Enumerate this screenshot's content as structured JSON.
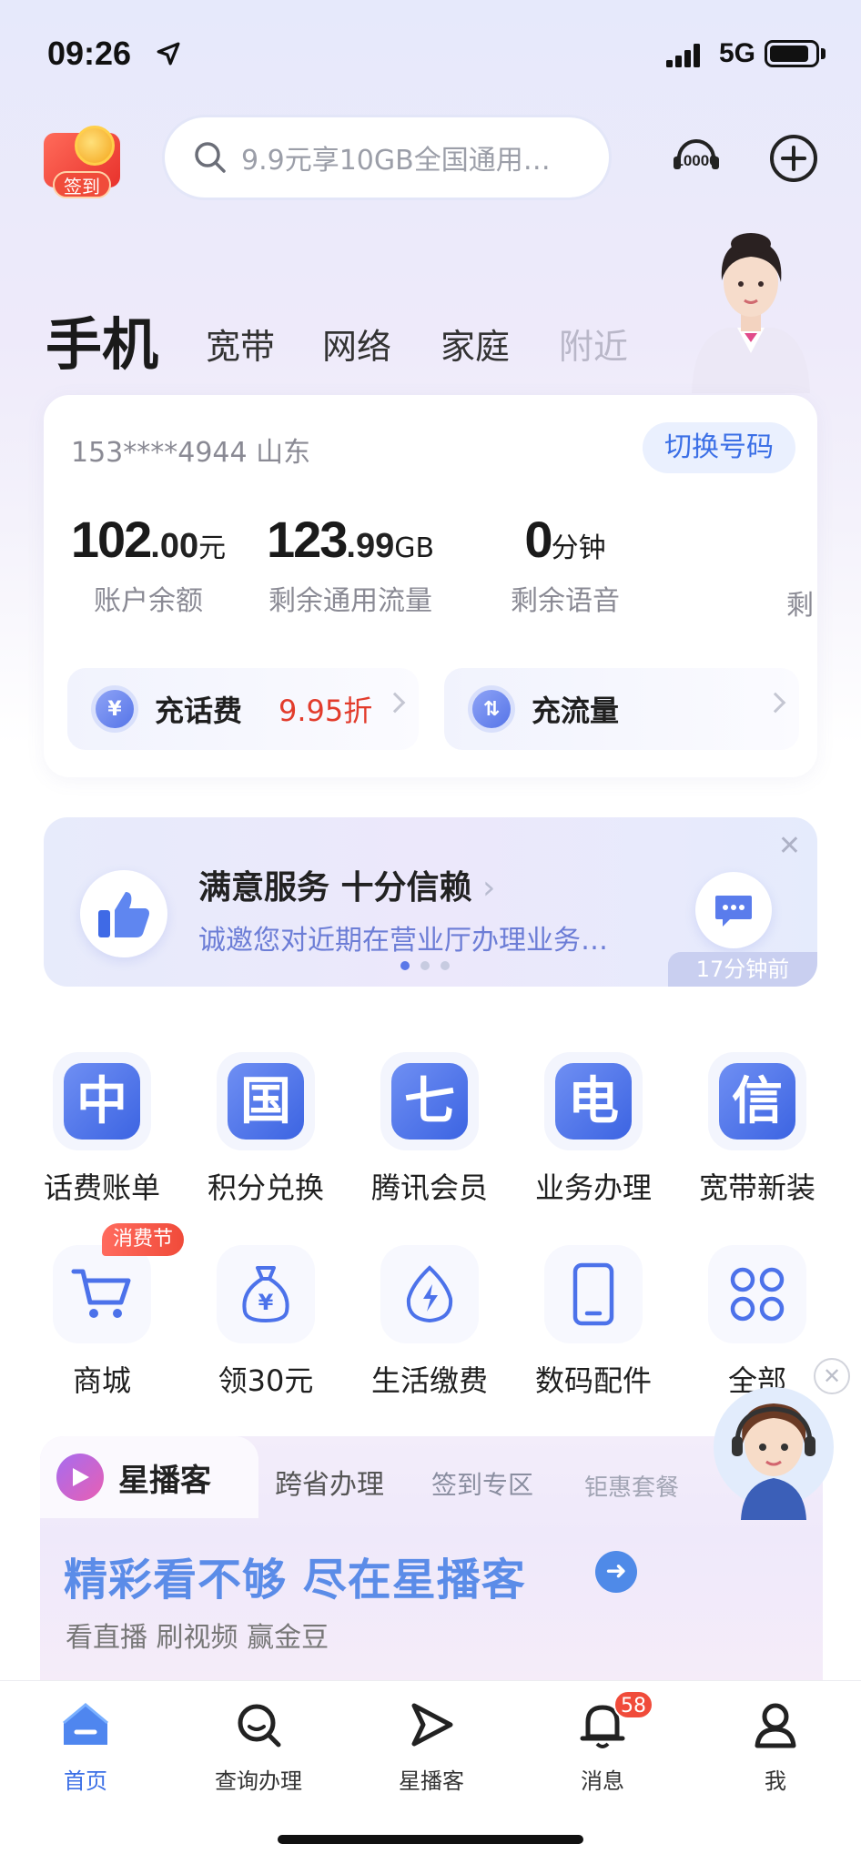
{
  "status_bar": {
    "time": "09:26",
    "network": "5G"
  },
  "header": {
    "checkin_label": "签到",
    "search_placeholder": "9.9元享10GB全国通用…",
    "hotline_icon": "10000-hotline-icon",
    "add_icon": "plus-circle-icon"
  },
  "tabs": {
    "active": "手机",
    "items": [
      "宽带",
      "网络",
      "家庭",
      "附近"
    ]
  },
  "account": {
    "phone": "153****4944",
    "region": "山东",
    "switch_label": "切换号码",
    "stats": [
      {
        "int": "102",
        "dec": ".00",
        "unit": "元",
        "label": "账户余额"
      },
      {
        "int": "123",
        "dec": ".99",
        "unit": "GB",
        "label": "剩余通用流量"
      },
      {
        "int": "0",
        "dec": "",
        "unit": "分钟",
        "label": "剩余语音"
      }
    ],
    "stat_cut_label": "剩",
    "recharge_label": "充话费",
    "recharge_promo": "9.95折",
    "data_label": "充流量"
  },
  "feedback_banner": {
    "title": "满意服务 十分信赖",
    "subtitle": "诚邀您对近期在营业厅办理业务…",
    "time": "17分钟前",
    "page": 1,
    "pages": 3
  },
  "grid_row1": [
    {
      "glyph": "中",
      "label": "话费账单"
    },
    {
      "glyph": "国",
      "label": "积分兑换"
    },
    {
      "glyph": "七",
      "label": "腾讯会员"
    },
    {
      "glyph": "电",
      "label": "业务办理"
    },
    {
      "glyph": "信",
      "label": "宽带新装"
    }
  ],
  "grid_row2": [
    {
      "icon": "cart-icon",
      "label": "商城"
    },
    {
      "icon": "money-bag-icon",
      "label": "领30元"
    },
    {
      "icon": "bolt-icon",
      "label": "生活缴费"
    },
    {
      "icon": "phone-device-icon",
      "label": "数码配件"
    },
    {
      "icon": "apps-grid-icon",
      "label": "全部"
    }
  ],
  "festival_badge": "消费节",
  "star_section": {
    "name": "星播客",
    "tabs": [
      "跨省办理",
      "签到专区",
      "钜惠套餐"
    ],
    "headline": "精彩看不够 尽在星播客",
    "sub": "看直播 刷视频 赢金豆"
  },
  "bottom_nav": {
    "items": [
      {
        "label": "首页"
      },
      {
        "label": "查询办理"
      },
      {
        "label": "星播客"
      },
      {
        "label": "消息"
      },
      {
        "label": "我"
      }
    ],
    "badge": "58"
  },
  "colors": {
    "accent": "#3b6fe6",
    "promo": "#e23c2c",
    "badge": "#f04b3a"
  }
}
